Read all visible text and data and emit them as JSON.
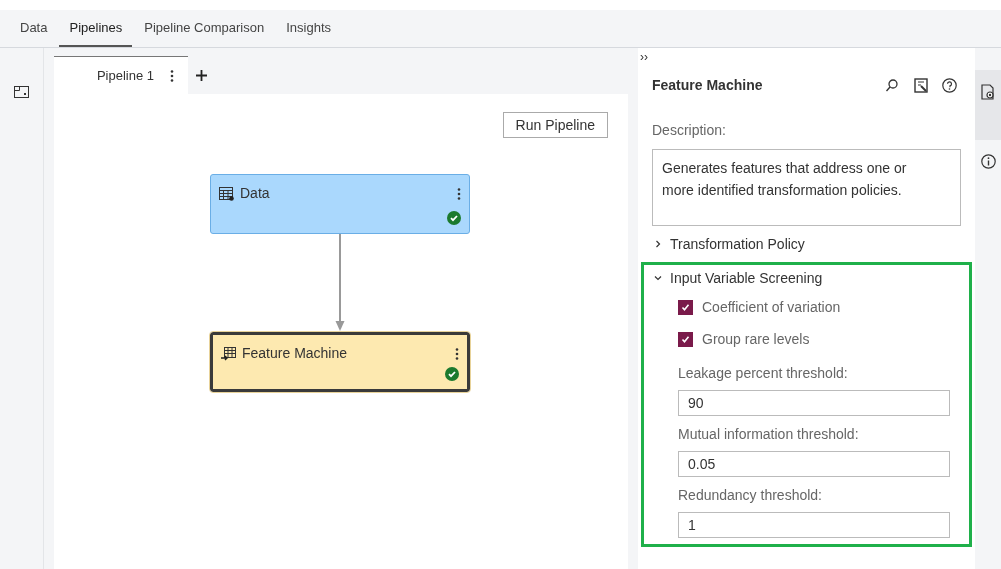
{
  "tabs": [
    {
      "label": "Data",
      "selected": false
    },
    {
      "label": "Pipelines",
      "selected": true
    },
    {
      "label": "Pipeline Comparison",
      "selected": false
    },
    {
      "label": "Insights",
      "selected": false
    }
  ],
  "pipeline_tabs": [
    {
      "label": "Pipeline 1",
      "selected": true
    }
  ],
  "run_button": "Run Pipeline",
  "nodes": [
    {
      "kind": "data",
      "label": "Data",
      "selected": false,
      "completed": true
    },
    {
      "kind": "feature",
      "label": "Feature Machine",
      "selected": true,
      "completed": true
    }
  ],
  "panel": {
    "collapse": "››",
    "title": "Feature Machine",
    "description_label": "Description:",
    "description": "Generates features that address one or more identified transformation policies.",
    "sections": [
      {
        "title": "Transformation Policy",
        "expanded": false,
        "highlighted": false
      },
      {
        "title": "Input Variable Screening",
        "expanded": true,
        "highlighted": true,
        "options": [
          {
            "kind": "checkbox",
            "label": "Coefficient of variation",
            "checked": true
          },
          {
            "kind": "checkbox",
            "label": "Group rare levels",
            "checked": true
          },
          {
            "kind": "number",
            "label": "Leakage percent threshold:",
            "value": "90"
          },
          {
            "kind": "number",
            "label": "Mutual information threshold:",
            "value": "0.05"
          },
          {
            "kind": "number",
            "label": "Redundancy threshold:",
            "value": "1"
          }
        ]
      }
    ]
  }
}
